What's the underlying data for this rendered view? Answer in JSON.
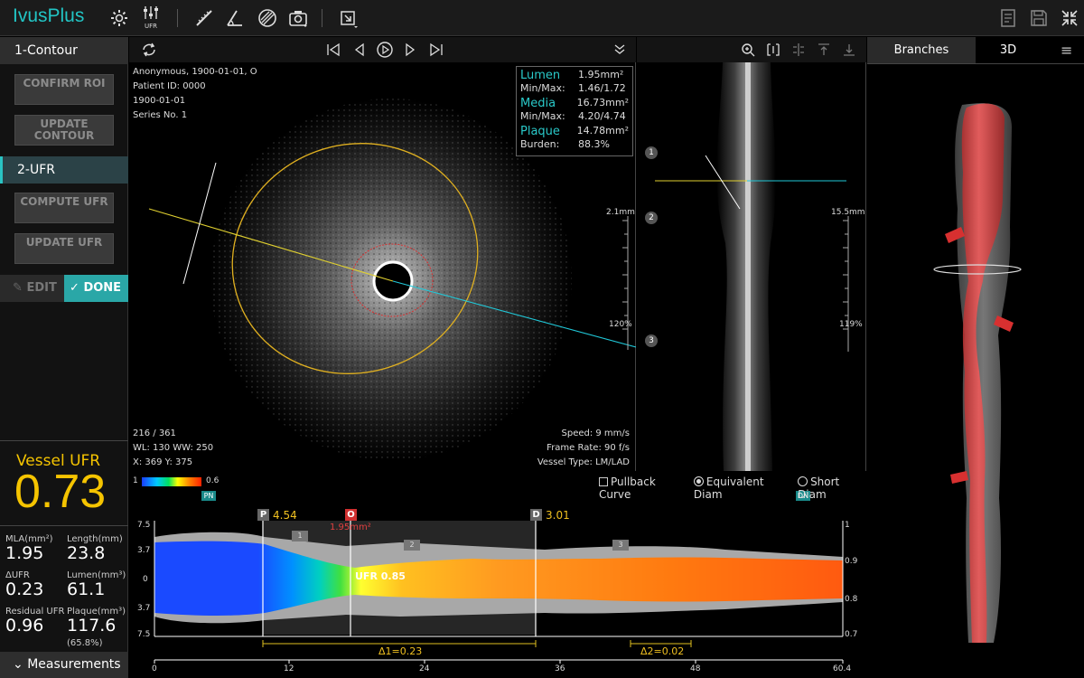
{
  "app": {
    "title": "IvusPlus"
  },
  "toolbar": {
    "icons": [
      "gear-icon",
      "ufr-settings-icon",
      "ruler-icon",
      "angle-icon",
      "hatch-icon",
      "camera-icon",
      "export-icon",
      "report-icon",
      "save-icon",
      "collapse-icon"
    ],
    "ufr_icon_label": "UFR"
  },
  "left": {
    "section1": "1-Contour",
    "confirm_roi": "CONFIRM ROI",
    "update_contour": "UPDATE CONTOUR",
    "section2": "2-UFR",
    "compute_ufr": "COMPUTE UFR",
    "update_ufr": "UPDATE UFR",
    "edit": "EDIT",
    "done": "DONE",
    "vessel_ufr_label": "Vessel UFR",
    "vessel_ufr_value": "0.73",
    "metrics": [
      {
        "label": "MLA(mm²)",
        "value": "1.95"
      },
      {
        "label": "Length(mm)",
        "value": "23.8"
      },
      {
        "label": "ΔUFR",
        "value": "0.23"
      },
      {
        "label": "Lumen(mm³)",
        "value": "61.1"
      },
      {
        "label": "Residual UFR",
        "value": "0.96"
      },
      {
        "label": "Plaque(mm³)",
        "value": "117.6"
      }
    ],
    "plaque_pct": "(65.8%)",
    "measurements": "Measurements"
  },
  "ivus": {
    "patient_line1": "Anonymous, 1900-01-01, O",
    "patient_line2": "Patient ID: 0000",
    "patient_line3": "1900-01-01",
    "patient_line4": "Series No. 1",
    "frame": "216 / 361",
    "wl_ww": "WL: 130  WW: 250",
    "xy": "X: 369  Y: 375",
    "speed": "Speed: 9 mm/s",
    "frame_rate": "Frame Rate: 90 f/s",
    "vessel_type": "Vessel Type: LM/LAD",
    "scale_top": "2.1mm",
    "scale_pct": "120%",
    "lumen_name": "Lumen",
    "lumen_value": "1.95mm²",
    "lumen_minmax_label": "Min/Max:",
    "lumen_minmax": "1.46/1.72",
    "media_name": "Media",
    "media_value": "16.73mm²",
    "media_minmax_label": "Min/Max:",
    "media_minmax": "4.20/4.74",
    "plaque_name": "Plaque",
    "plaque_value": "14.78mm²",
    "burden_label": "Burden:",
    "burden_value": "88.3%"
  },
  "longi": {
    "scale_top": "15.5mm",
    "scale_pct": "119%",
    "markers": [
      "1",
      "2",
      "3"
    ]
  },
  "panel3d": {
    "tab_branches": "Branches",
    "tab_3d": "3D"
  },
  "chart": {
    "colorbar_min": "1",
    "colorbar_max": "0.6",
    "pn": "PN",
    "dn": "DN",
    "opt_pullback": "Pullback Curve",
    "opt_equiv": "Equivalent Diam",
    "opt_short": "Short Diam",
    "p_label": "P",
    "p_value": "4.54",
    "o_label": "O",
    "o_value": "1.95mm²",
    "d_label": "D",
    "d_value": "3.01",
    "ufr_center": "UFR 0.85",
    "delta1": "Δ1=0.23",
    "delta2": "Δ2=0.02",
    "seg_labels": [
      "1",
      "2",
      "3"
    ],
    "y_left": [
      "7.5",
      "3.7",
      "0",
      "3.7",
      "7.5"
    ],
    "y_right": [
      "1",
      "0.9",
      "0.8",
      "0.7"
    ],
    "x_ticks": [
      "0",
      "12",
      "24",
      "36",
      "48",
      "60.4"
    ]
  }
}
